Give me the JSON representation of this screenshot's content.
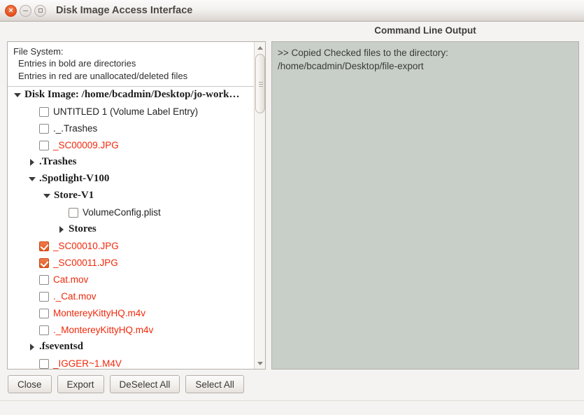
{
  "window": {
    "title": "Disk Image Access Interface",
    "controls": {
      "close": "close-icon",
      "minimize": "minimize-icon",
      "maximize": "maximize-icon"
    },
    "accent_color": "#e95420",
    "chrome_color": "#f4f3f1"
  },
  "tree_panel": {
    "header": {
      "line1": "File System:",
      "line2": "Entries in bold are directories",
      "line3": "Entries in red are unallocated/deleted files"
    },
    "deleted_color": "#f0280a",
    "items": [
      {
        "label": "Disk Image: /home/bcadmin/Desktop/jo-work…",
        "type": "dir",
        "expander": "open",
        "checkbox": "none",
        "indent": 0,
        "red": false
      },
      {
        "label": "UNTITLED 1  (Volume Label Entry)",
        "type": "file",
        "expander": "none",
        "checkbox": "off",
        "indent": 1,
        "red": false
      },
      {
        "label": "._.Trashes",
        "type": "file",
        "expander": "none",
        "checkbox": "off",
        "indent": 1,
        "red": false
      },
      {
        "label": "_SC00009.JPG",
        "type": "file",
        "expander": "none",
        "checkbox": "off",
        "indent": 1,
        "red": true
      },
      {
        "label": ".Trashes",
        "type": "dir",
        "expander": "closed",
        "checkbox": "none",
        "indent": 1,
        "red": false
      },
      {
        "label": ".Spotlight-V100",
        "type": "dir",
        "expander": "open",
        "checkbox": "none",
        "indent": 1,
        "red": false
      },
      {
        "label": "Store-V1",
        "type": "dir",
        "expander": "open",
        "checkbox": "none",
        "indent": 2,
        "red": false
      },
      {
        "label": "VolumeConfig.plist",
        "type": "file",
        "expander": "none",
        "checkbox": "off",
        "indent": 3,
        "red": false
      },
      {
        "label": "Stores",
        "type": "dir",
        "expander": "closed",
        "checkbox": "none",
        "indent": 3,
        "red": false
      },
      {
        "label": "_SC00010.JPG",
        "type": "file",
        "expander": "none",
        "checkbox": "on",
        "indent": 1,
        "red": true
      },
      {
        "label": "_SC00011.JPG",
        "type": "file",
        "expander": "none",
        "checkbox": "on",
        "indent": 1,
        "red": true
      },
      {
        "label": "Cat.mov",
        "type": "file",
        "expander": "none",
        "checkbox": "off",
        "indent": 1,
        "red": true
      },
      {
        "label": "._Cat.mov",
        "type": "file",
        "expander": "none",
        "checkbox": "off",
        "indent": 1,
        "red": true
      },
      {
        "label": "MontereyKittyHQ.m4v",
        "type": "file",
        "expander": "none",
        "checkbox": "off",
        "indent": 1,
        "red": true
      },
      {
        "label": "._MontereyKittyHQ.m4v",
        "type": "file",
        "expander": "none",
        "checkbox": "off",
        "indent": 1,
        "red": true
      },
      {
        "label": ".fseventsd",
        "type": "dir",
        "expander": "closed",
        "checkbox": "none",
        "indent": 1,
        "red": false
      },
      {
        "label": "_IGGER~1.M4V",
        "type": "file",
        "expander": "none",
        "checkbox": "off",
        "indent": 1,
        "red": true
      }
    ],
    "scrollbar": {
      "up_arrow": "scroll-up-icon",
      "down_arrow": "scroll-down-icon"
    }
  },
  "command_output": {
    "heading": "Command Line Output",
    "line1": ">> Copied Checked files to the directory:",
    "line2": "/home/bcadmin/Desktop/file-export",
    "background_color": "#c8cfc8"
  },
  "buttons": {
    "close": "Close",
    "export": "Export",
    "deselect_all": "DeSelect All",
    "select_all": "Select All"
  }
}
